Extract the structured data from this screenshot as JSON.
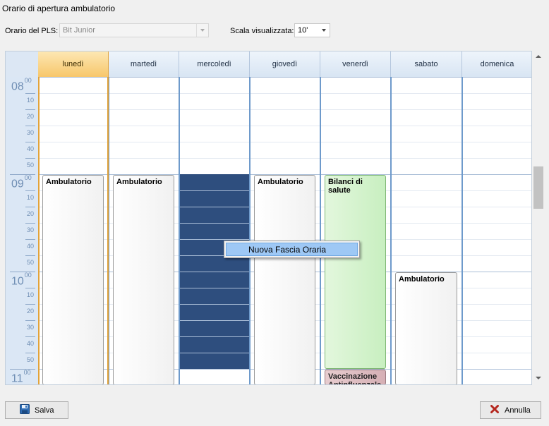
{
  "window": {
    "title": "Orario di apertura ambulatorio"
  },
  "toolbar": {
    "pls_label": "Orario del PLS:",
    "pls_value": "Bit Junior",
    "scale_label": "Scala visualizzata:",
    "scale_value": "10'"
  },
  "calendar": {
    "days": [
      "lunedì",
      "martedì",
      "mercoledì",
      "giovedì",
      "venerdì",
      "sabato",
      "domenica"
    ],
    "today_index": 0,
    "hours": [
      {
        "hour": "08",
        "suffix": "00",
        "minutes": [
          "10",
          "20",
          "30",
          "40",
          "50"
        ]
      },
      {
        "hour": "09",
        "suffix": "00",
        "minutes": [
          "10",
          "20",
          "30",
          "40",
          "50"
        ]
      },
      {
        "hour": "10",
        "suffix": "00",
        "minutes": [
          "10",
          "20",
          "30",
          "40",
          "50"
        ]
      },
      {
        "hour": "11",
        "suffix": "00",
        "minutes": []
      }
    ],
    "appointments": [
      {
        "day": "lunedì",
        "title": "Ambulatorio",
        "start": "09:00",
        "end": "11:10",
        "color": "#ffffff"
      },
      {
        "day": "martedì",
        "title": "Ambulatorio",
        "start": "09:00",
        "end": "11:10",
        "color": "#ffffff"
      },
      {
        "day": "giovedì",
        "title": "Ambulatorio",
        "start": "09:00",
        "end": "11:10",
        "color": "#ffffff"
      },
      {
        "day": "venerdì",
        "title": "Bilanci di salute",
        "start": "09:00",
        "end": "11:00",
        "color": "#c8efc0"
      },
      {
        "day": "venerdì",
        "title": "Vaccinazione Antinfluenzale",
        "start": "11:00",
        "end": "11:10",
        "color": "#d6b0b5"
      },
      {
        "day": "sabato",
        "title": "Ambulatorio",
        "start": "10:00",
        "end": "11:10",
        "color": "#ffffff"
      }
    ],
    "selection": {
      "day": "mercoledì",
      "start": "09:00",
      "end": "11:00",
      "color": "#2e4e7e"
    }
  },
  "context_menu": {
    "items": [
      "Nuova Fascia Oraria"
    ]
  },
  "footer": {
    "save_label": "Salva",
    "cancel_label": "Annulla"
  },
  "colors": {
    "today_header": "#f7c76b",
    "selection": "#2e4e7e",
    "time_column": "#dbe7f5"
  }
}
